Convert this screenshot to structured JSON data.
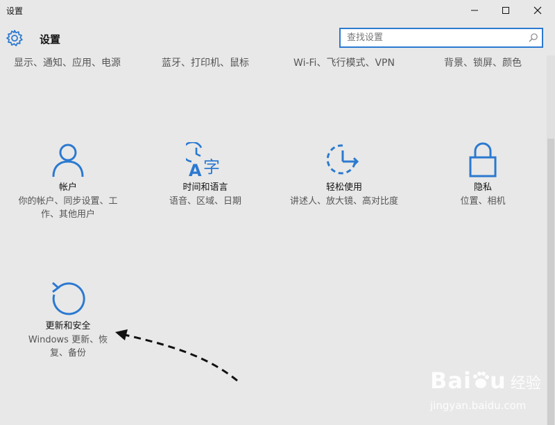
{
  "window": {
    "title": "设置"
  },
  "header": {
    "title": "设置",
    "search_placeholder": "查找设置"
  },
  "top_categories": [
    {
      "desc": "显示、通知、应用、电源"
    },
    {
      "desc": "蓝牙、打印机、鼠标"
    },
    {
      "desc": "Wi-Fi、飞行模式、VPN"
    },
    {
      "desc": "背景、锁屏、颜色"
    }
  ],
  "tiles": [
    {
      "name": "帐户",
      "desc": "你的帐户、同步设置、工作、其他用户",
      "icon": "person-icon"
    },
    {
      "name": "时间和语言",
      "desc": "语音、区域、日期",
      "icon": "clock-language-icon"
    },
    {
      "name": "轻松使用",
      "desc": "讲述人、放大镜、高对比度",
      "icon": "ease-of-access-icon"
    },
    {
      "name": "隐私",
      "desc": "位置、相机",
      "icon": "lock-icon"
    },
    {
      "name": "更新和安全",
      "desc": "Windows 更新、恢复、备份",
      "icon": "update-icon"
    }
  ],
  "icon_glyphs": {
    "language_char": "字"
  },
  "watermark": {
    "brand": "Bai",
    "brand_suffix": "u",
    "cn": "经验",
    "url": "jingyan.baidu.com"
  },
  "colors": {
    "accent": "#2b79d0",
    "background": "#e8e8e8"
  }
}
